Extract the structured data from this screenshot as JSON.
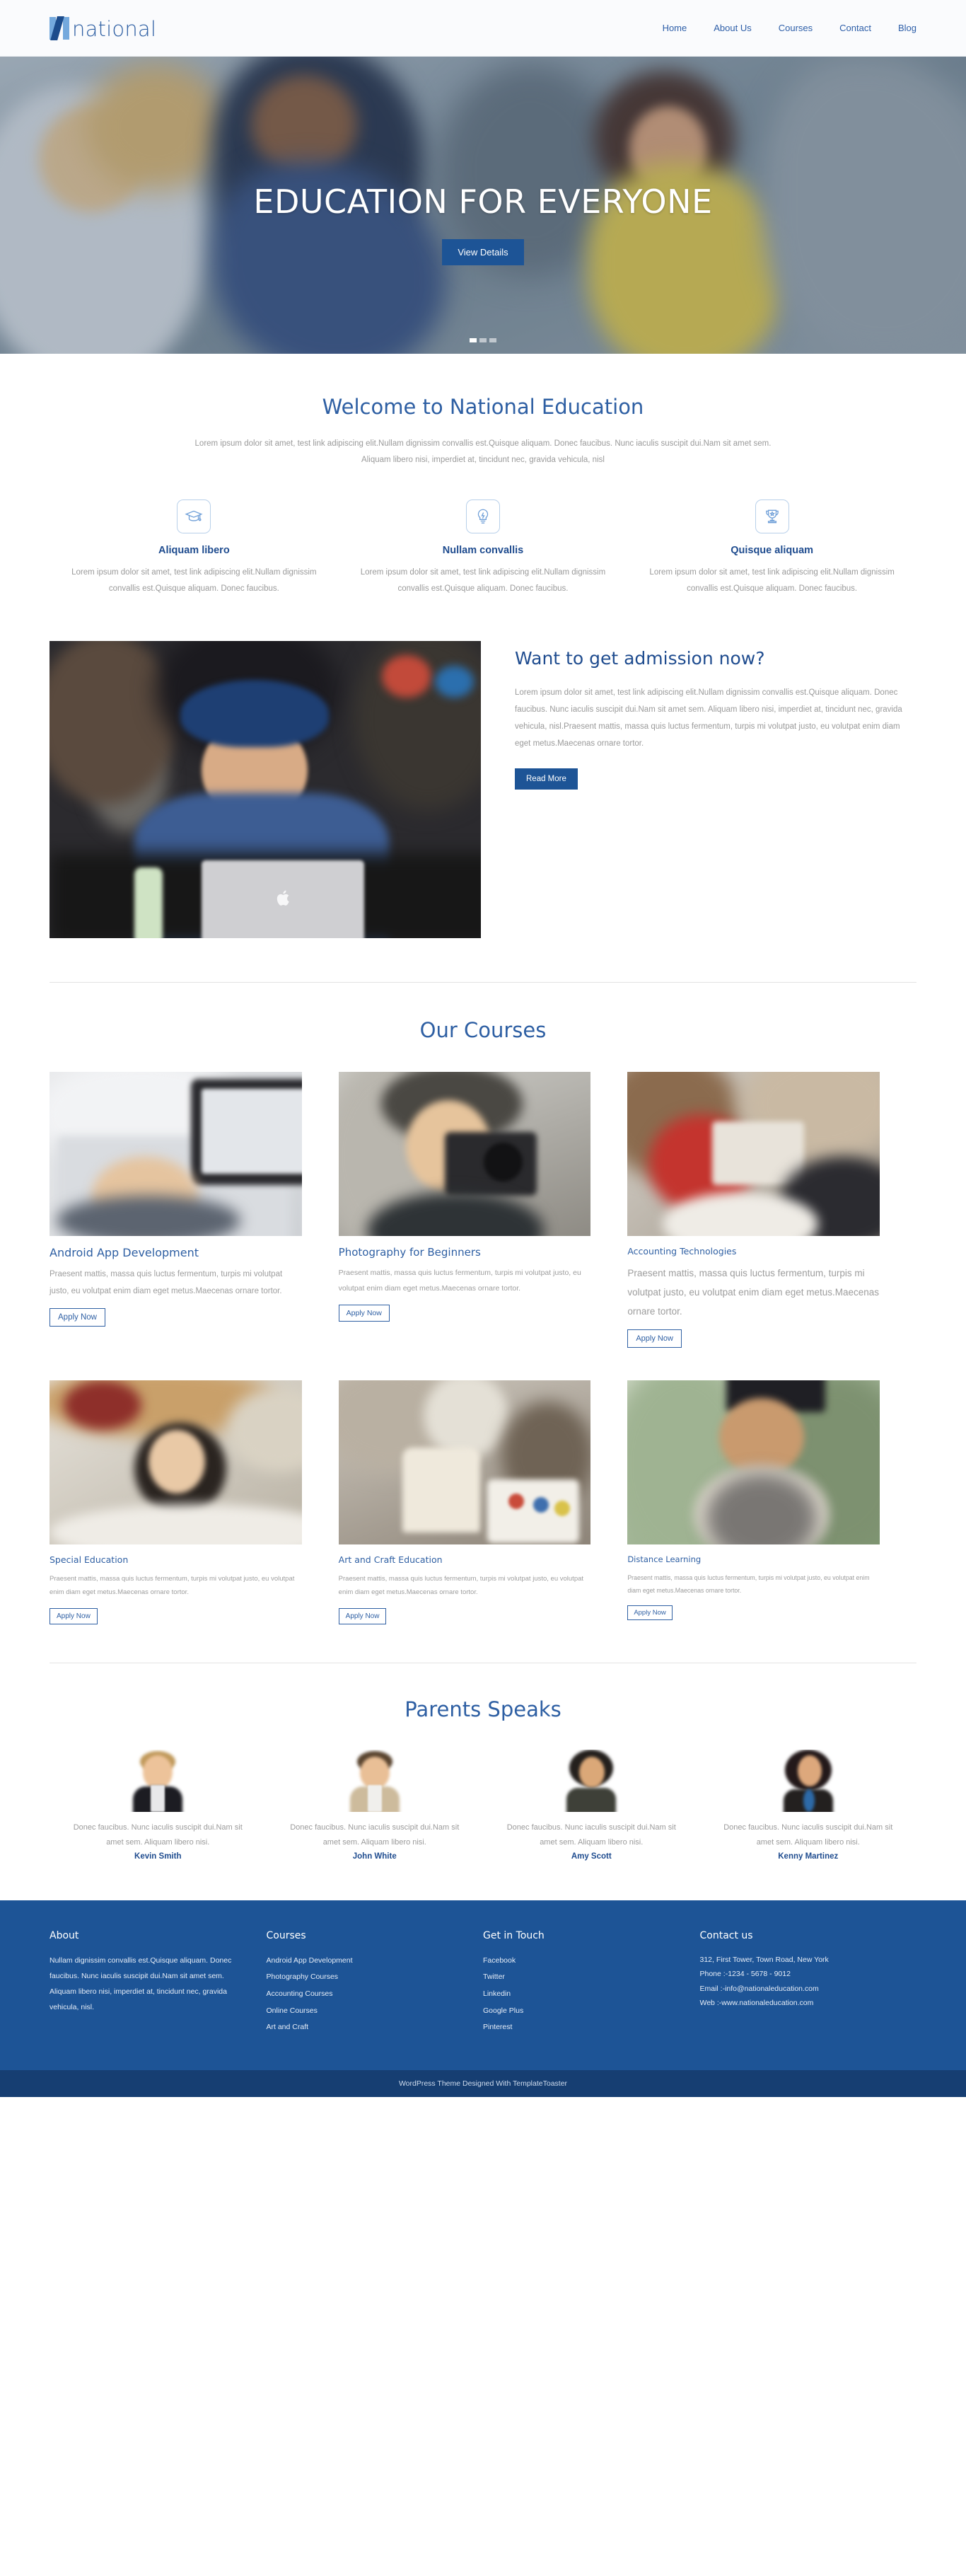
{
  "header": {
    "logo_text": "national",
    "nav": [
      {
        "label": "Home"
      },
      {
        "label": "About Us"
      },
      {
        "label": "Courses"
      },
      {
        "label": "Contact"
      },
      {
        "label": "Blog"
      }
    ]
  },
  "hero": {
    "title": "EDUCATION FOR EVERYONE",
    "button": "View Details",
    "slides": 3,
    "active_slide": 1
  },
  "welcome": {
    "title": "Welcome to National Education",
    "lead": "Lorem ipsum dolor sit amet, test link adipiscing elit.Nullam dignissim convallis est.Quisque aliquam. Donec faucibus. Nunc iaculis suscipit dui.Nam sit amet sem. Aliquam libero nisi, imperdiet at, tincidunt nec, gravida vehicula, nisl",
    "features": [
      {
        "icon": "graduation-cap-icon",
        "title": "Aliquam libero",
        "text": "Lorem ipsum dolor sit amet, test link adipiscing elit.Nullam dignissim convallis est.Quisque aliquam. Donec faucibus."
      },
      {
        "icon": "lightbulb-icon",
        "title": "Nullam convallis",
        "text": "Lorem ipsum dolor sit amet, test link adipiscing elit.Nullam dignissim convallis est.Quisque aliquam. Donec faucibus."
      },
      {
        "icon": "trophy-icon",
        "title": "Quisque aliquam",
        "text": "Lorem ipsum dolor sit amet, test link adipiscing elit.Nullam dignissim convallis est.Quisque aliquam. Donec faucibus."
      }
    ]
  },
  "admission": {
    "image_alt": "student-with-headphones-at-laptop",
    "title": "Want to get admission now?",
    "text": "Lorem ipsum dolor sit amet, test link adipiscing elit.Nullam dignissim convallis est.Quisque aliquam. Donec faucibus. Nunc iaculis suscipit dui.Nam sit amet sem. Aliquam libero nisi, imperdiet at, tincidunt nec, gravida vehicula, nisl.Praesent mattis, massa quis luctus fermentum, turpis mi volutpat justo, eu volutpat enim diam eget metus.Maecenas ornare tortor.",
    "button": "Read More"
  },
  "courses": {
    "title": "Our Courses",
    "items": [
      {
        "title": "Android App Development",
        "text": "Praesent mattis, massa quis luctus fermentum, turpis mi volutpat justo, eu volutpat enim diam eget metus.Maecenas ornare tortor.",
        "button": "Apply Now",
        "image_alt": "hands-typing-on-laptop"
      },
      {
        "title": "Photography for Beginners",
        "text": "Praesent mattis, massa quis luctus fermentum, turpis mi volutpat justo, eu volutpat enim diam eget metus.Maecenas ornare tortor.",
        "button": "Apply Now",
        "image_alt": "person-holding-camera"
      },
      {
        "title": "Accounting Technologies",
        "text": "Praesent mattis, massa quis luctus fermentum, turpis mi volutpat justo, eu volutpat enim diam eget metus.Maecenas ornare tortor.",
        "button": "Apply Now",
        "image_alt": "hands-with-calculator-and-documents"
      },
      {
        "title": "Special Education",
        "text": "Praesent mattis, massa quis luctus fermentum, turpis mi volutpat justo, eu volutpat enim diam eget metus.Maecenas ornare tortor.",
        "button": "Apply Now",
        "image_alt": "student-reading-in-classroom"
      },
      {
        "title": "Art and Craft Education",
        "text": "Praesent mattis, massa quis luctus fermentum, turpis mi volutpat justo, eu volutpat enim diam eget metus.Maecenas ornare tortor.",
        "button": "Apply Now",
        "image_alt": "paint-brushes-and-palette"
      },
      {
        "title": "Distance Learning",
        "text": "Praesent mattis, massa quis luctus fermentum, turpis mi volutpat justo, eu volutpat enim diam eget metus.Maecenas ornare tortor.",
        "button": "Apply Now",
        "image_alt": "graduate-in-cap-smiling"
      }
    ]
  },
  "testimonials": {
    "title": "Parents Speaks",
    "items": [
      {
        "text": "Donec faucibus. Nunc iaculis suscipit dui.Nam sit amet sem. Aliquam libero nisi.",
        "name": "Kevin Smith",
        "avatar_alt": "blond-man-in-black-suit"
      },
      {
        "text": "Donec faucibus. Nunc iaculis suscipit dui.Nam sit amet sem. Aliquam libero nisi.",
        "name": "John White",
        "avatar_alt": "man-with-glasses-in-beige-jacket"
      },
      {
        "text": "Donec faucibus. Nunc iaculis suscipit dui.Nam sit amet sem. Aliquam libero nisi.",
        "name": "Amy Scott",
        "avatar_alt": "woman-with-dark-hair-in-grey-jacket"
      },
      {
        "text": "Donec faucibus. Nunc iaculis suscipit dui.Nam sit amet sem. Aliquam libero nisi.",
        "name": "Kenny Martinez",
        "avatar_alt": "woman-with-long-dark-hair-in-blazer"
      }
    ]
  },
  "footer": {
    "about": {
      "heading": "About",
      "text": "Nullam dignissim convallis est.Quisque aliquam. Donec faucibus. Nunc iaculis suscipit dui.Nam sit amet sem. Aliquam libero nisi, imperdiet at, tincidunt nec, gravida vehicula, nisl."
    },
    "courses": {
      "heading": "Courses",
      "links": [
        {
          "label": "Android App Development"
        },
        {
          "label": "Photography Courses"
        },
        {
          "label": "Accounting Courses"
        },
        {
          "label": "Online Courses"
        },
        {
          "label": "Art and Craft"
        }
      ]
    },
    "social": {
      "heading": "Get in Touch",
      "links": [
        {
          "label": "Facebook"
        },
        {
          "label": "Twitter"
        },
        {
          "label": "Linkedin"
        },
        {
          "label": "Google Plus"
        },
        {
          "label": "Pinterest"
        }
      ]
    },
    "contact": {
      "heading": "Contact us",
      "lines": [
        "312, First Tower, Town Road, New York",
        "Phone :-1234 - 5678 - 9012",
        "Email :-info@nationaleducation.com",
        "Web :-www.nationaleducation.com"
      ]
    },
    "copyright": "WordPress Theme Designed With TemplateToaster"
  },
  "colors": {
    "brand_blue": "#1d5496",
    "link_blue": "#2e5fa3",
    "heading_blue": "#1f4c8f",
    "footer_bg": "#1d5496",
    "copyright_bg": "#163e72",
    "body_text": "#9a9a9a"
  }
}
